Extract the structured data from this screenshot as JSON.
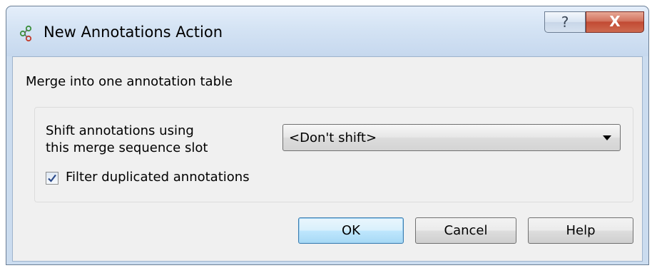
{
  "window": {
    "title": "New Annotations Action",
    "icon": "annotations-action-icon",
    "help_glyph": "?",
    "close_glyph": "X"
  },
  "content": {
    "heading": "Merge into one annotation table",
    "shift_label_line1": "Shift annotations using",
    "shift_label_line2": "this merge sequence slot",
    "shift_select_value": "<Don't shift>",
    "filter_checkbox_label": "Filter duplicated annotations",
    "filter_checkbox_checked": true
  },
  "buttons": {
    "ok": "OK",
    "cancel": "Cancel",
    "help": "Help"
  },
  "colors": {
    "title_gradient_top": "#e4eefa",
    "close_button": "#c24a33",
    "default_button_border": "#3c7fb1"
  }
}
